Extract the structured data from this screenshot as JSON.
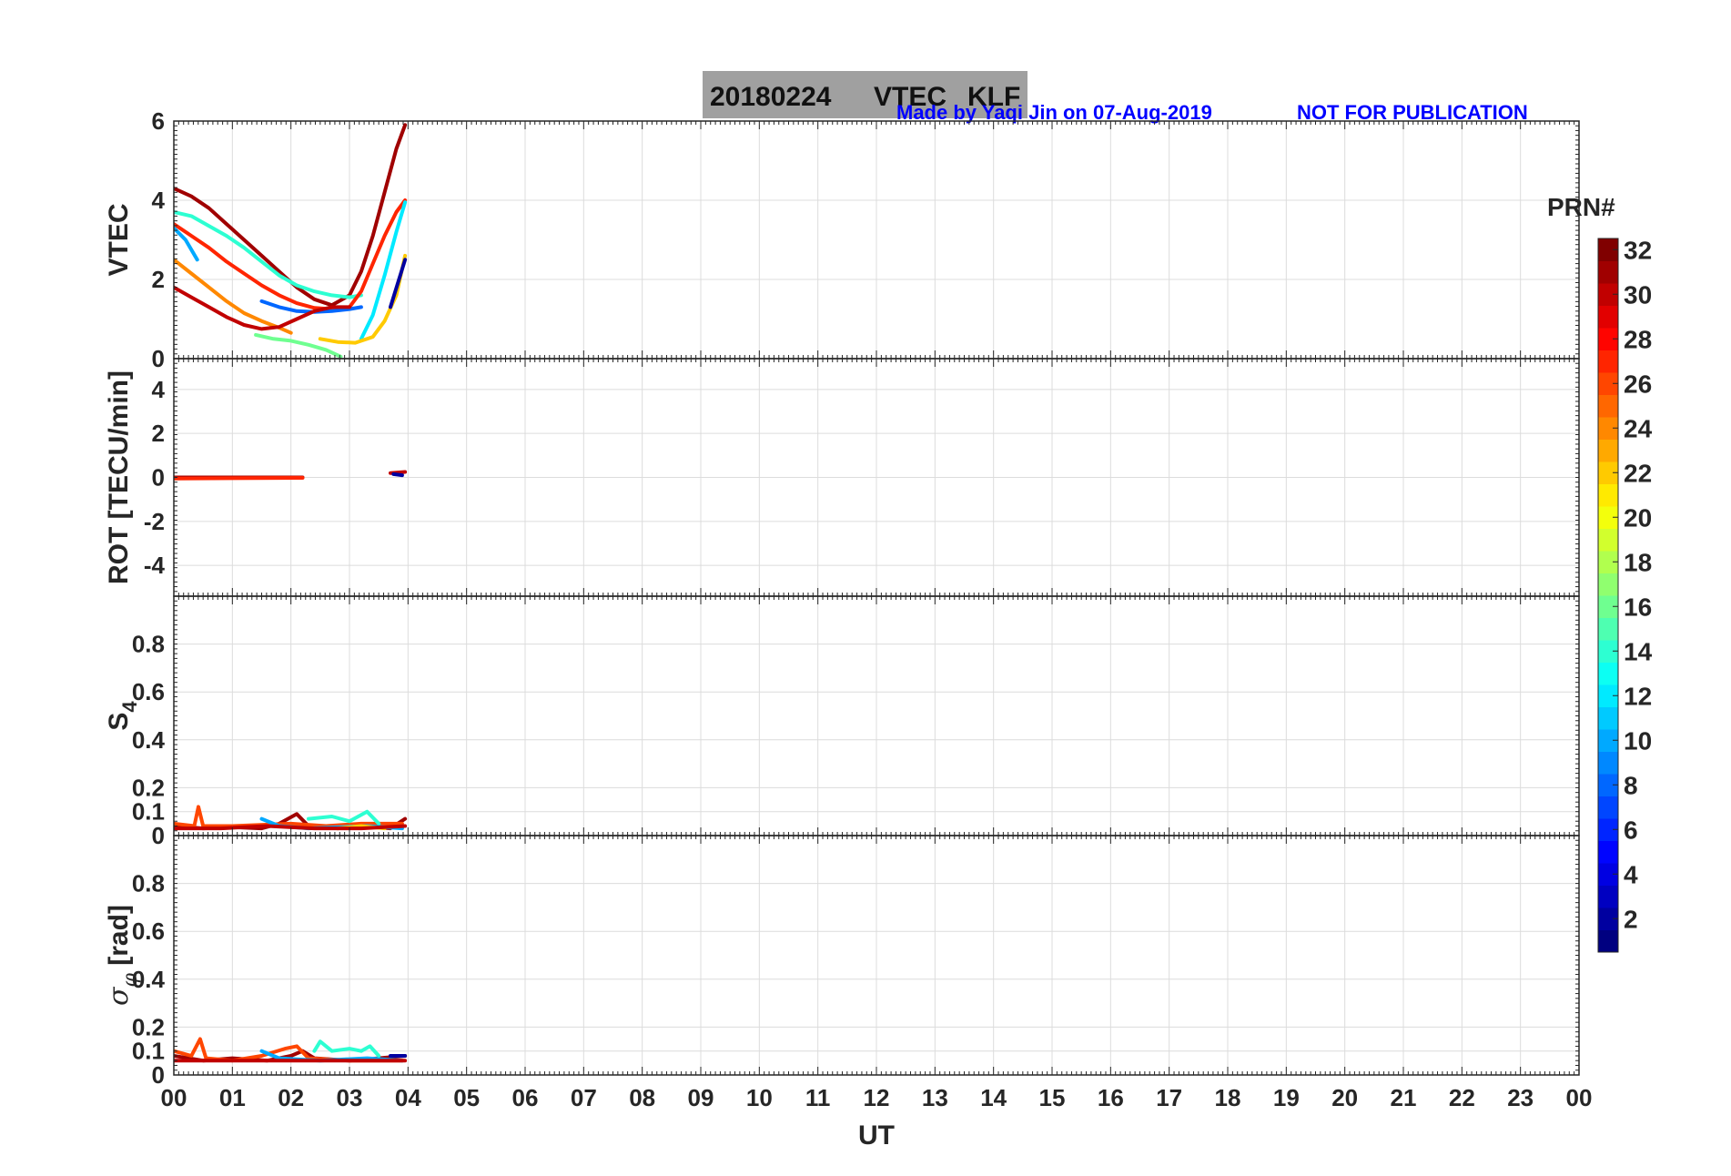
{
  "title": {
    "date": "20180224",
    "product": "VTEC",
    "station": "KLF",
    "credit": "Made by Yaqi Jin on 07-Aug-2019",
    "notice": "NOT FOR PUBLICATION",
    "credit_color": "#0000ff",
    "box_color": "#a0a0a0"
  },
  "colorbar": {
    "label": "PRN#",
    "ticks": [
      "2",
      "4",
      "6",
      "8",
      "10",
      "12",
      "14",
      "16",
      "18",
      "20",
      "22",
      "24",
      "26",
      "28",
      "30",
      "32"
    ],
    "range": [
      1,
      32
    ],
    "colormap": "jet"
  },
  "chart_data": [
    {
      "type": "line",
      "panel": "vtec",
      "ylabel": "VTEC",
      "ylim": [
        0,
        6
      ],
      "yticks": [
        "0",
        "2",
        "4",
        "6"
      ],
      "xlim": [
        0,
        24
      ],
      "grid": true,
      "series": [
        {
          "prn": 31,
          "points": [
            [
              0,
              4.3
            ],
            [
              0.3,
              4.1
            ],
            [
              0.6,
              3.8
            ],
            [
              0.9,
              3.4
            ],
            [
              1.2,
              3.0
            ],
            [
              1.5,
              2.6
            ],
            [
              1.8,
              2.2
            ],
            [
              2.1,
              1.8
            ],
            [
              2.4,
              1.5
            ],
            [
              2.7,
              1.35
            ],
            [
              3.0,
              1.6
            ],
            [
              3.2,
              2.2
            ],
            [
              3.4,
              3.1
            ],
            [
              3.6,
              4.2
            ],
            [
              3.8,
              5.3
            ],
            [
              3.95,
              5.9
            ]
          ]
        },
        {
          "prn": 14,
          "points": [
            [
              0,
              3.7
            ],
            [
              0.3,
              3.6
            ],
            [
              0.6,
              3.35
            ],
            [
              0.9,
              3.1
            ],
            [
              1.2,
              2.8
            ],
            [
              1.5,
              2.45
            ],
            [
              1.8,
              2.1
            ],
            [
              2.1,
              1.85
            ],
            [
              2.4,
              1.7
            ],
            [
              2.7,
              1.6
            ],
            [
              3.0,
              1.55
            ],
            [
              3.2,
              1.6
            ]
          ]
        },
        {
          "prn": 27,
          "points": [
            [
              0,
              3.4
            ],
            [
              0.3,
              3.1
            ],
            [
              0.6,
              2.8
            ],
            [
              0.9,
              2.45
            ],
            [
              1.2,
              2.15
            ],
            [
              1.5,
              1.85
            ],
            [
              1.8,
              1.6
            ],
            [
              2.1,
              1.4
            ],
            [
              2.4,
              1.28
            ],
            [
              2.7,
              1.25
            ],
            [
              3.0,
              1.3
            ],
            [
              3.2,
              1.7
            ],
            [
              3.4,
              2.4
            ],
            [
              3.6,
              3.1
            ],
            [
              3.8,
              3.7
            ],
            [
              3.95,
              4.0
            ]
          ]
        },
        {
          "prn": 8,
          "points": [
            [
              1.5,
              1.45
            ],
            [
              1.8,
              1.3
            ],
            [
              2.1,
              1.2
            ],
            [
              2.4,
              1.18
            ],
            [
              2.7,
              1.2
            ],
            [
              3.0,
              1.25
            ],
            [
              3.2,
              1.3
            ]
          ]
        },
        {
          "prn": 10,
          "points": [
            [
              0,
              3.3
            ],
            [
              0.2,
              3.0
            ],
            [
              0.4,
              2.5
            ]
          ]
        },
        {
          "prn": 12,
          "points": [
            [
              3.2,
              0.5
            ],
            [
              3.4,
              1.1
            ],
            [
              3.6,
              2.1
            ],
            [
              3.8,
              3.2
            ],
            [
              3.95,
              3.95
            ]
          ]
        },
        {
          "prn": 24,
          "points": [
            [
              0,
              2.5
            ],
            [
              0.3,
              2.15
            ],
            [
              0.6,
              1.8
            ],
            [
              0.9,
              1.45
            ],
            [
              1.2,
              1.15
            ],
            [
              1.5,
              0.95
            ],
            [
              1.8,
              0.78
            ],
            [
              2.0,
              0.65
            ]
          ]
        },
        {
          "prn": 30,
          "points": [
            [
              0,
              1.8
            ],
            [
              0.3,
              1.55
            ],
            [
              0.6,
              1.3
            ],
            [
              0.9,
              1.05
            ],
            [
              1.2,
              0.85
            ],
            [
              1.5,
              0.75
            ],
            [
              1.8,
              0.8
            ],
            [
              2.1,
              1.0
            ],
            [
              2.4,
              1.2
            ],
            [
              2.7,
              1.3
            ],
            [
              3.0,
              1.3
            ]
          ]
        },
        {
          "prn": 22,
          "points": [
            [
              2.5,
              0.5
            ],
            [
              2.8,
              0.42
            ],
            [
              3.1,
              0.4
            ],
            [
              3.4,
              0.55
            ],
            [
              3.6,
              0.95
            ],
            [
              3.8,
              1.6
            ],
            [
              3.95,
              2.6
            ]
          ]
        },
        {
          "prn": 16,
          "points": [
            [
              1.4,
              0.6
            ],
            [
              1.7,
              0.5
            ],
            [
              2.0,
              0.45
            ],
            [
              2.3,
              0.35
            ],
            [
              2.6,
              0.22
            ],
            [
              2.85,
              0.05
            ]
          ]
        },
        {
          "prn": 2,
          "points": [
            [
              3.7,
              1.3
            ],
            [
              3.95,
              2.5
            ]
          ]
        }
      ]
    },
    {
      "type": "line",
      "panel": "rot",
      "ylabel": "ROT [TECU/min]",
      "ylim": [
        -5.4,
        5.4
      ],
      "yticks": [
        "-4",
        "-2",
        "0",
        "2",
        "4"
      ],
      "xlim": [
        0,
        24
      ],
      "grid": true,
      "series": [
        {
          "prn": 31,
          "points": [
            [
              0,
              0
            ],
            [
              2.2,
              0
            ]
          ]
        },
        {
          "prn": 27,
          "points": [
            [
              0,
              -0.05
            ],
            [
              2.2,
              -0.02
            ]
          ]
        },
        {
          "prn": 30,
          "points": [
            [
              3.7,
              0.2
            ],
            [
              3.95,
              0.25
            ]
          ]
        },
        {
          "prn": 2,
          "points": [
            [
              3.75,
              0.15
            ],
            [
              3.9,
              0.1
            ]
          ]
        }
      ]
    },
    {
      "type": "line",
      "panel": "s4",
      "ylabel": "S4",
      "ylim": [
        0,
        1
      ],
      "yticks": [
        "0",
        "0.1",
        "0.2",
        "0.4",
        "0.6",
        "0.8"
      ],
      "xlim": [
        0,
        24
      ],
      "grid": true,
      "series": [
        {
          "prn": 31,
          "points": [
            [
              0,
              0.04
            ],
            [
              0.5,
              0.03
            ],
            [
              1.0,
              0.035
            ],
            [
              1.5,
              0.03
            ],
            [
              1.8,
              0.05
            ],
            [
              2.1,
              0.09
            ],
            [
              2.3,
              0.04
            ],
            [
              2.8,
              0.03
            ],
            [
              3.3,
              0.04
            ],
            [
              3.7,
              0.03
            ],
            [
              3.95,
              0.07
            ]
          ]
        },
        {
          "prn": 26,
          "points": [
            [
              0,
              0.05
            ],
            [
              0.35,
              0.04
            ],
            [
              0.42,
              0.12
            ],
            [
              0.5,
              0.04
            ],
            [
              1.0,
              0.04
            ],
            [
              2.0,
              0.05
            ],
            [
              2.6,
              0.04
            ],
            [
              3.2,
              0.05
            ],
            [
              3.9,
              0.05
            ]
          ]
        },
        {
          "prn": 14,
          "points": [
            [
              2.3,
              0.07
            ],
            [
              2.7,
              0.08
            ],
            [
              3.0,
              0.06
            ],
            [
              3.3,
              0.1
            ],
            [
              3.5,
              0.05
            ]
          ]
        },
        {
          "prn": 10,
          "points": [
            [
              1.5,
              0.07
            ],
            [
              1.8,
              0.04
            ],
            [
              2.3,
              0.03
            ],
            [
              3.3,
              0.04
            ],
            [
              3.9,
              0.03
            ]
          ]
        },
        {
          "prn": 22,
          "points": [
            [
              2.8,
              0.03
            ],
            [
              3.2,
              0.04
            ],
            [
              3.6,
              0.03
            ]
          ]
        },
        {
          "prn": 30,
          "points": [
            [
              0,
              0.03
            ],
            [
              0.8,
              0.03
            ],
            [
              1.6,
              0.04
            ],
            [
              2.4,
              0.03
            ],
            [
              3.2,
              0.03
            ],
            [
              3.95,
              0.04
            ]
          ]
        }
      ]
    },
    {
      "type": "line",
      "panel": "sigma_phi",
      "ylabel": "σφ [rad]",
      "ylim": [
        0,
        1
      ],
      "yticks": [
        "0",
        "0.1",
        "0.2",
        "0.4",
        "0.6",
        "0.8"
      ],
      "xlim": [
        0,
        24
      ],
      "xlabel": "UT",
      "xticks": [
        "00",
        "01",
        "02",
        "03",
        "04",
        "05",
        "06",
        "07",
        "08",
        "09",
        "10",
        "11",
        "12",
        "13",
        "14",
        "15",
        "16",
        "17",
        "18",
        "19",
        "20",
        "21",
        "22",
        "23",
        "00"
      ],
      "grid": true,
      "series": [
        {
          "prn": 31,
          "points": [
            [
              0,
              0.08
            ],
            [
              0.5,
              0.06
            ],
            [
              1.0,
              0.07
            ],
            [
              1.6,
              0.06
            ],
            [
              2.0,
              0.08
            ],
            [
              2.2,
              0.1
            ],
            [
              2.4,
              0.07
            ],
            [
              3.0,
              0.06
            ],
            [
              3.5,
              0.07
            ],
            [
              3.95,
              0.08
            ]
          ]
        },
        {
          "prn": 26,
          "points": [
            [
              0,
              0.1
            ],
            [
              0.3,
              0.08
            ],
            [
              0.45,
              0.15
            ],
            [
              0.55,
              0.07
            ],
            [
              1.0,
              0.06
            ],
            [
              1.5,
              0.08
            ],
            [
              1.9,
              0.11
            ],
            [
              2.1,
              0.12
            ],
            [
              2.3,
              0.07
            ],
            [
              3.0,
              0.06
            ],
            [
              3.9,
              0.06
            ]
          ]
        },
        {
          "prn": 14,
          "points": [
            [
              2.4,
              0.1
            ],
            [
              2.5,
              0.14
            ],
            [
              2.7,
              0.1
            ],
            [
              3.0,
              0.11
            ],
            [
              3.2,
              0.1
            ],
            [
              3.35,
              0.12
            ],
            [
              3.5,
              0.08
            ]
          ]
        },
        {
          "prn": 10,
          "points": [
            [
              1.5,
              0.1
            ],
            [
              1.8,
              0.07
            ],
            [
              2.5,
              0.06
            ],
            [
              3.3,
              0.07
            ],
            [
              3.9,
              0.06
            ]
          ]
        },
        {
          "prn": 2,
          "points": [
            [
              3.7,
              0.08
            ],
            [
              3.95,
              0.08
            ]
          ]
        },
        {
          "prn": 30,
          "points": [
            [
              0,
              0.06
            ],
            [
              1.0,
              0.06
            ],
            [
              2.0,
              0.06
            ],
            [
              3.0,
              0.06
            ],
            [
              3.95,
              0.06
            ]
          ]
        }
      ]
    }
  ]
}
